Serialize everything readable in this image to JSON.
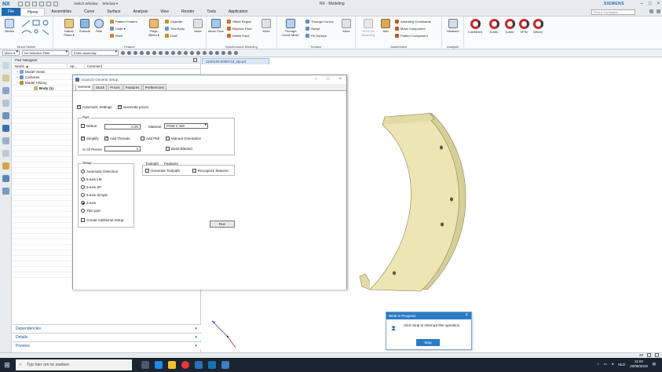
{
  "app": {
    "logo": "NX",
    "window_title": "NX - Modeling",
    "brand": "SIEMENS",
    "switch_window": "Switch Window",
    "window_menu": "Window ▾"
  },
  "ribbon_tabs": [
    "File",
    "Home",
    "Assemblies",
    "Curve",
    "Surface",
    "Analysis",
    "View",
    "Render",
    "Tools",
    "Application"
  ],
  "command_finder_placeholder": "Find a Command",
  "ribbon": {
    "sketch": "Sketch",
    "direct_sketch": "Direct Sketch",
    "datum_plane": "Datum Plane ▾",
    "extrude": "Extrude",
    "hole": "Hole",
    "pattern_feature": "Pattern Feature",
    "unite": "Unite ▾",
    "shell": "Shell",
    "edge_blend": "Edge Blend ▾",
    "chamfer": "Chamfer",
    "trim_body": "Trim Body",
    "draft": "Draft",
    "more1": "More",
    "feature": "Feature",
    "move_face": "Move Face",
    "offset_region": "Offset Region",
    "replace_face": "Replace Face",
    "delete_face": "Delete Face",
    "more2": "More",
    "sync_modeling": "Synchronous Modeling",
    "through_curve_mesh": "Through Curve Mesh",
    "through_curves": "Through Curves",
    "swept": "Swept",
    "fill_surface": "Fill Surface",
    "more3": "More",
    "surface": "Surface",
    "work_on_assembly": "Work on Assembly",
    "add": "Add",
    "assembly_constraints": "Assembly Constraints",
    "move_component": "Move Component",
    "pattern_component": "Pattern Component",
    "assemblies": "Assemblies",
    "measure": "Measure",
    "analysis": "Analysis",
    "combined": "Combined",
    "five_axis": "5-axis",
    "three_axis": "3-axis",
    "spin": "SPIN",
    "deburr": "Deburr"
  },
  "toolbar": {
    "menu": "Menu ▾",
    "selection_filter": "No Selection Filter",
    "assembly_scope": "Entire Assembly"
  },
  "part_navigator": {
    "title": "Part Navigator",
    "columns": [
      "Name ▲",
      "Up...",
      "Comment"
    ],
    "rows": [
      {
        "label": "Model Views",
        "toggle": "+",
        "bold": false,
        "indent": 0
      },
      {
        "label": "Cameras",
        "toggle": "+",
        "bold": false,
        "indent": 0
      },
      {
        "label": "Model History",
        "toggle": "−",
        "bold": false,
        "indent": 0
      },
      {
        "label": "Body (1)",
        "toggle": "",
        "bold": true,
        "indent": 1
      }
    ],
    "sections": [
      "Dependencies",
      "Details",
      "Preview"
    ]
  },
  "graphics_tab": "1120140-2005719_stp.prt",
  "dialog": {
    "title": "Vcam(3) General Setup",
    "tabs": [
      "General",
      "Stock",
      "Prices",
      "Features",
      "Preferences"
    ],
    "automatic_settings": "Automatic Settings",
    "generate_prices": "Generate prices",
    "part_legend": "Part",
    "deburr": "Deburr",
    "deburr_value": "0.25",
    "material_label": "Material",
    "material_value": "POM-C Wit",
    "simplify": "Simplify",
    "add_threads": "Add Threads",
    "add_pmi": "Add PMI",
    "manual_orientation": "Manual Orientation",
    "nr_of_pieces": "nr Of Pieces",
    "nr_of_pieces_value": "2",
    "bead_blasted": "Bead Blasted",
    "setup_legend": "Setup",
    "setup_options": [
      "Automatic Detection",
      "5-axis LM",
      "5-axis SP",
      "5-axis Simple",
      "3-axis",
      "Thin part"
    ],
    "create_additional_setup": "Create Additional Setup",
    "toolpath_legend": "Toolpath",
    "features_legend": "Features",
    "generate_toolpath": "Generate Toolpath",
    "recognize_features": "Recognize features",
    "run": "Run"
  },
  "work_in_progress": {
    "title": "Work in Progress",
    "message": "Click Stop to interrupt this operation.",
    "stop": "Stop"
  },
  "statusbar": {
    "zoom": "20"
  },
  "taskbar": {
    "search_placeholder": "Typ hier om te zoeken",
    "language": "NLD",
    "time": "11:03",
    "date": "20/06/2019"
  },
  "colors": {
    "accent": "#1c6ab3",
    "part_fill": "#ece6b4",
    "part_stroke": "#8a8454",
    "taskbar": "#1b2430"
  }
}
